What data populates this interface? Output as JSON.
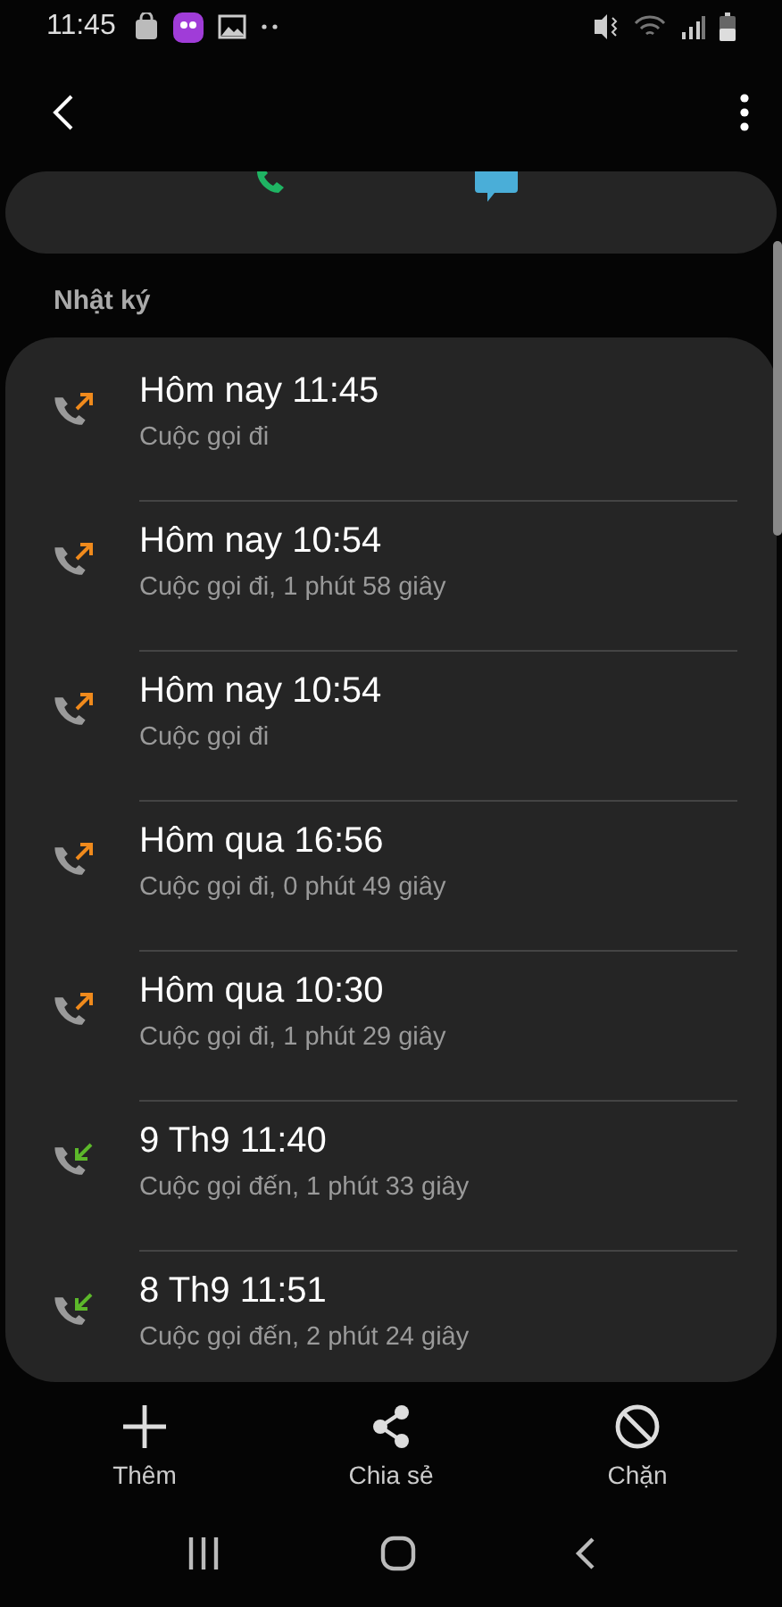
{
  "status_bar": {
    "time": "11:45"
  },
  "section_title": "Nhật ký",
  "calls": [
    {
      "kind": "outgoing",
      "title": "Hôm nay 11:45",
      "detail": "Cuộc gọi đi"
    },
    {
      "kind": "outgoing",
      "title": "Hôm nay 10:54",
      "detail": "Cuộc gọi đi, 1 phút 58 giây"
    },
    {
      "kind": "outgoing",
      "title": "Hôm nay 10:54",
      "detail": "Cuộc gọi đi"
    },
    {
      "kind": "outgoing",
      "title": "Hôm qua 16:56",
      "detail": "Cuộc gọi đi, 0 phút 49 giây"
    },
    {
      "kind": "outgoing",
      "title": "Hôm qua 10:30",
      "detail": "Cuộc gọi đi, 1 phút 29 giây"
    },
    {
      "kind": "incoming",
      "title": "9 Th9 11:40",
      "detail": "Cuộc gọi đến, 1 phút 33 giây"
    },
    {
      "kind": "incoming",
      "title": "8 Th9 11:51",
      "detail": "Cuộc gọi đến, 2 phút 24 giây"
    }
  ],
  "bottom_actions": [
    {
      "kind": "add",
      "label": "Thêm"
    },
    {
      "kind": "share",
      "label": "Chia sẻ"
    },
    {
      "kind": "block",
      "label": "Chặn"
    }
  ]
}
